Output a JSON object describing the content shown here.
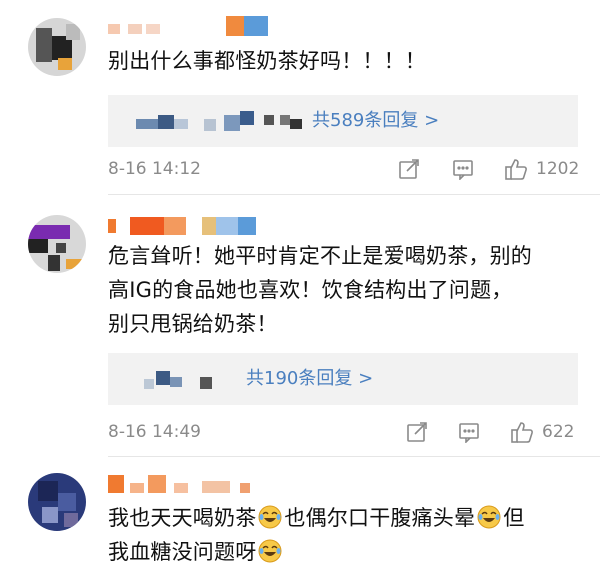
{
  "comments": [
    {
      "text": "别出什么事都怪奶茶好吗！！！！",
      "replies_label": "共589条回复 >",
      "time": "8-16 14:12",
      "likes": "1202"
    },
    {
      "text_line1": "危言耸听！她平时肯定不止是爱喝奶茶，别的",
      "text_line2": "高IG的食品她也喜欢！饮食结构出了问题，",
      "text_line3": "别只甩锅给奶茶！",
      "replies_label": "共190条回复 >",
      "time": "8-16 14:49",
      "likes": "622"
    },
    {
      "text_part1": "我也天天喝奶茶",
      "text_part2": "也偶尔口干腹痛头晕",
      "text_part3": "但",
      "text_line2": "我血糖没问题呀"
    }
  ],
  "icons": {
    "share": "share-icon",
    "comment": "comment-icon",
    "like": "thumbs-up-icon",
    "emoji": "laughing-crying-emoji-icon"
  },
  "colors": {
    "link": "#4a7fbf",
    "meta": "#8a8a8a",
    "reply_bg": "#f2f2f2"
  }
}
